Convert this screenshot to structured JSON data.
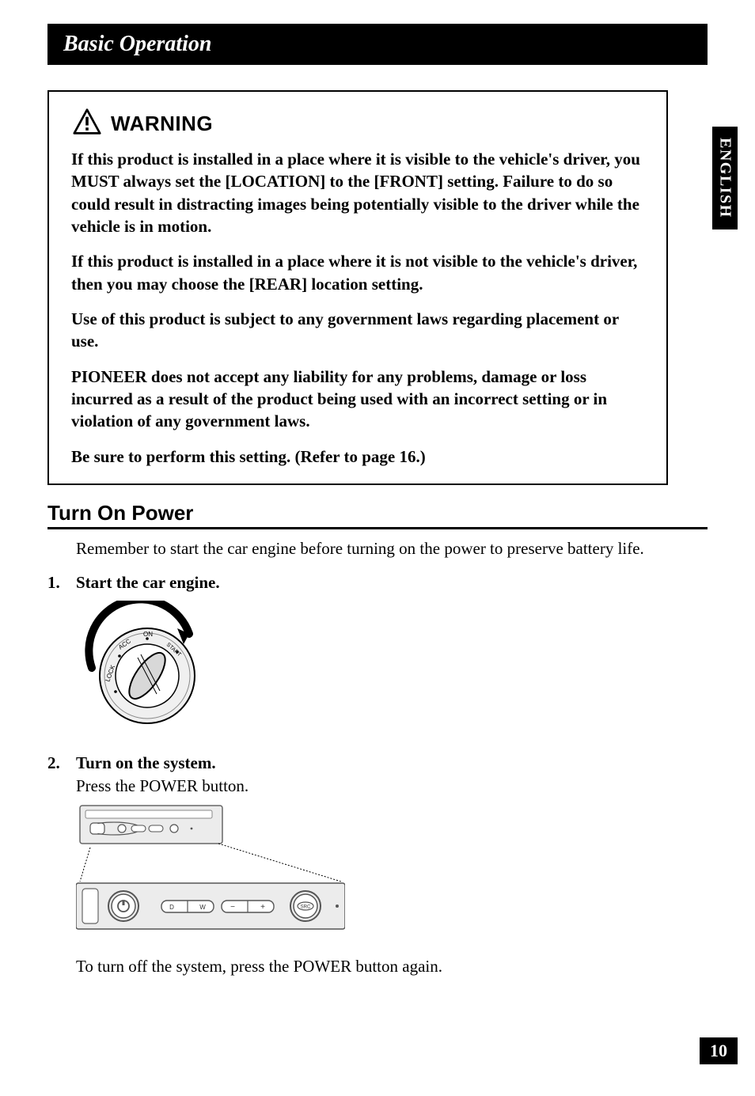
{
  "section_header": "Basic Operation",
  "warning": {
    "title": "WARNING",
    "paras": [
      "If this product is installed in a place where it is visible to the vehicle's driver, you MUST always set the [LOCATION] to the [FRONT] setting. Failure to do so could result in distracting images being potentially visible to the driver while the vehicle is in motion.",
      "If this product is installed in a place where it is not visible to the vehicle's driver, then you may choose the [REAR] location setting.",
      "Use of this product is subject to any government laws regarding placement or use.",
      "PIONEER does not accept any liability for any problems, damage or loss incurred as a result of the product being used with an incorrect setting or in violation of any government laws.",
      "Be sure to perform this setting. (Refer to page 16.)"
    ]
  },
  "subsection": {
    "title": "Turn On Power",
    "intro": "Remember to start the car engine before turning on the power to preserve battery life.",
    "steps": [
      {
        "num": "1.",
        "title": "Start the car engine.",
        "sub": ""
      },
      {
        "num": "2.",
        "title": "Turn on the system.",
        "sub": "Press the POWER button."
      }
    ],
    "after_note": "To turn off the system, press the POWER button again."
  },
  "ignition_labels": {
    "lock": "LOCK",
    "acc": "ACC",
    "on": "ON",
    "start": "START"
  },
  "panel_labels": {
    "d": "D",
    "w": "W",
    "minus": "−",
    "plus": "+",
    "src": "SRC"
  },
  "side_tab": "ENGLISH",
  "page_number": "10"
}
